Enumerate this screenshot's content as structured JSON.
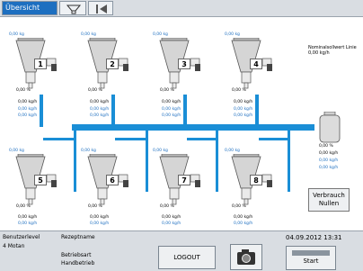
{
  "tabs": {
    "overview_label": "Übersicht"
  },
  "nominal": {
    "label": "Nominalsollwert Linie",
    "value": "0,00 kg/h"
  },
  "top_row": [
    {
      "num": "1",
      "top": "0,00 kg",
      "pct": "0,00 %",
      "v1": "0,00 kg/h",
      "v2": "0,00 kg/h",
      "v3": "0,00 kg/h"
    },
    {
      "num": "2",
      "top": "0,00 kg",
      "pct": "0,00 %",
      "v1": "0,00 kg/h",
      "v2": "0,00 kg/h",
      "v3": "0,00 kg/h"
    },
    {
      "num": "3",
      "top": "0,00 kg",
      "pct": "0,00 %",
      "v1": "0,00 kg/h",
      "v2": "0,00 kg/h",
      "v3": "0,00 kg/h"
    },
    {
      "num": "4",
      "top": "0,00 kg",
      "pct": "0,00 %",
      "v1": "0,00 kg/h",
      "v2": "0,00 kg/h",
      "v3": "0,00 kg/h"
    }
  ],
  "bottom_row": [
    {
      "num": "5",
      "top": "0,00 kg",
      "pct": "0,00 %",
      "v1": "0,00 kg/h",
      "v2": "0,00 kg/h",
      "v3": "0,00 kg/h"
    },
    {
      "num": "6",
      "top": "0,00 kg",
      "pct": "0,00 %",
      "v1": "0,00 kg/h",
      "v2": "0,00 kg/h",
      "v3": "0,00 kg/h"
    },
    {
      "num": "7",
      "top": "0,00 kg",
      "pct": "0,00 %",
      "v1": "0,00 kg/h",
      "v2": "0,00 kg/h",
      "v3": "0,00 kg/h"
    },
    {
      "num": "8",
      "top": "0,00 kg",
      "pct": "0,00 %",
      "v1": "0,00 kg/h",
      "v2": "0,00 kg/h",
      "v3": "0,00 kg/h"
    }
  ],
  "line_container": {
    "pct": "0,00 %",
    "v1": "0,00 kg/h",
    "v2": "0,00 kg/h",
    "v3": "0,00 kg/h"
  },
  "verbrauch_button": {
    "line1": "Verbrauch",
    "line2": "Nullen"
  },
  "bottom": {
    "user_level_label": "Benutzerlevel",
    "user_level_value": "4  Motan",
    "recipe_label": "Rezeptname",
    "mode_label": "Betriebsart",
    "mode_value": "Handbetrieb",
    "logout": "LOGOUT",
    "datetime": "04.09.2012 13:31",
    "start": "Start"
  },
  "colors": {
    "accent": "#1d6fc0",
    "pipe": "#1a8ed6",
    "panel": "#d9dde2"
  }
}
